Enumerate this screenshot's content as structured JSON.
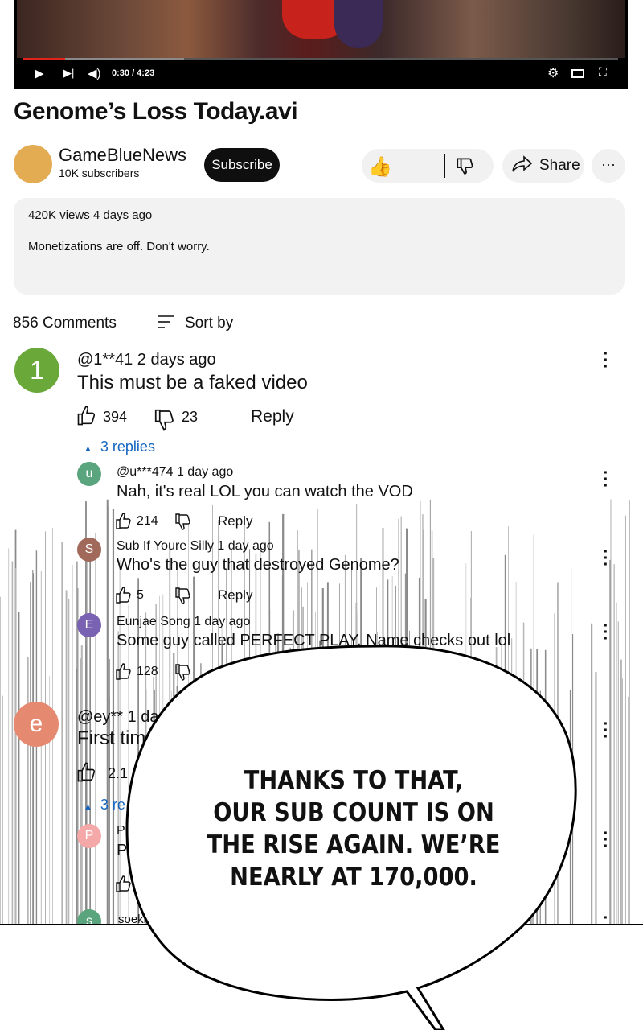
{
  "player": {
    "time": "0:30 / 4:23",
    "progress_fraction": 0.07,
    "icons": [
      "play-icon",
      "next-icon",
      "volume-icon",
      "settings-icon",
      "theater-icon",
      "fullscreen-icon"
    ]
  },
  "video": {
    "title": "Genome’s Loss Today.avi"
  },
  "channel": {
    "name": "GameBlueNews",
    "subscribers": "10K subscribers",
    "avatar_color": "#e3ac53"
  },
  "actions": {
    "subscribe_label": "Subscribe",
    "share_label": "Share",
    "more_label": "···"
  },
  "description": {
    "meta": "420K views 4 days ago",
    "text": "Monetizations are off. Don't worry."
  },
  "comments_header": {
    "count": "856 Comments",
    "sort_label": "Sort by"
  },
  "comments": [
    {
      "avatar_letter": "1",
      "avatar_color": "#6aa83a",
      "header": "@1**41 2 days ago",
      "text": "This must be a faked video",
      "likes": "394",
      "dislikes": "23",
      "reply_label": "Reply",
      "replies_toggle": "3 replies",
      "replies": [
        {
          "avatar_letter": "u",
          "avatar_color": "#5aa57d",
          "header": "@u***474 1 day ago",
          "text": "Nah, it's real LOL you can watch the VOD",
          "likes": "214",
          "reply_label": "Reply"
        },
        {
          "avatar_letter": "S",
          "avatar_color": "#a0695a",
          "header": "Sub If Youre Silly 1 day ago",
          "text": "Who's the guy that destroyed Genome?",
          "likes": "5",
          "reply_label": "Reply"
        },
        {
          "avatar_letter": "E",
          "avatar_color": "#7a62b3",
          "header": "Eunjae Song 1 day ago",
          "text": "Some guy called PERFECT PLAY. Name checks out lol",
          "likes": "128"
        }
      ]
    },
    {
      "avatar_letter": "e",
      "avatar_color": "#e58a70",
      "header": "@ey** 1 da",
      "text": "First tim",
      "likes": "2.1",
      "replies_toggle": "3 re",
      "replies": [
        {
          "avatar_letter": "P",
          "avatar_color": "#f4a9a8",
          "header": "P",
          "text": "P"
        },
        {
          "avatar_letter": "s",
          "avatar_color": "#5aa57d",
          "header": "soekk"
        }
      ]
    }
  ],
  "speech_bubble": {
    "line1": "THANKS TO THAT,",
    "line2": "OUR SUB COUNT IS ON",
    "line3": "THE RISE AGAIN. WE’RE",
    "line4": "NEARLY AT 170,000."
  }
}
